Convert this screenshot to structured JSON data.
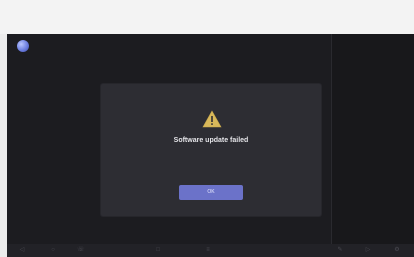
{
  "dialog": {
    "icon": "warning-triangle-icon",
    "title": "Software update failed",
    "message": "",
    "ok_label": "OK"
  },
  "status": {
    "icon": "globe-icon"
  },
  "nav_bar": {
    "icons": [
      "back-icon",
      "home-icon",
      "phone-icon",
      "recents-icon",
      "menu-icon",
      "edit-icon",
      "forward-icon",
      "settings-icon"
    ]
  },
  "colors": {
    "screen_bg": "#202025",
    "dialog_bg": "#2d2d33",
    "accent": "#6b72c9",
    "warning": "#d8b85a"
  }
}
